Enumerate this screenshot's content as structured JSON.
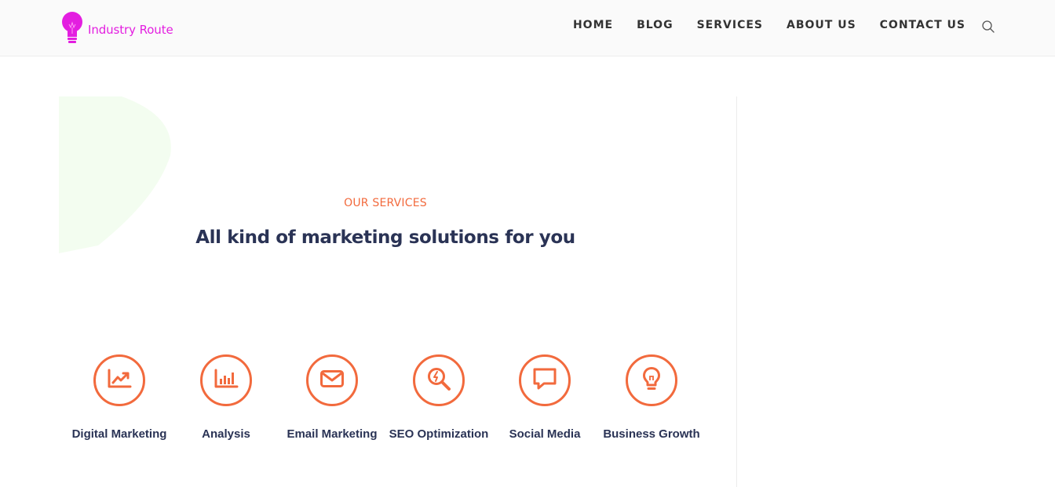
{
  "header": {
    "logo_text": "Industry Route",
    "nav": [
      {
        "label": "HOME"
      },
      {
        "label": "BLOG"
      },
      {
        "label": "SERVICES"
      },
      {
        "label": "ABOUT US"
      },
      {
        "label": "CONTACT US"
      }
    ],
    "search_icon": "search-icon"
  },
  "section": {
    "eyebrow": "OUR SERVICES",
    "headline": "All kind of marketing solutions for you"
  },
  "services": [
    {
      "label": "Digital Marketing",
      "icon": "chart-trend-icon"
    },
    {
      "label": "Analysis",
      "icon": "bar-chart-icon"
    },
    {
      "label": "Email Marketing",
      "icon": "envelope-icon"
    },
    {
      "label": "SEO Optimization",
      "icon": "seo-magnifier-icon"
    },
    {
      "label": "Social Media",
      "icon": "chat-bubble-icon"
    },
    {
      "label": "Business Growth",
      "icon": "lightbulb-icon"
    }
  ],
  "colors": {
    "accent": "#f26a3d",
    "brand": "#e31ee0",
    "heading": "#2a3355",
    "nav_text": "#333333",
    "decor": "#f3fdf0"
  }
}
